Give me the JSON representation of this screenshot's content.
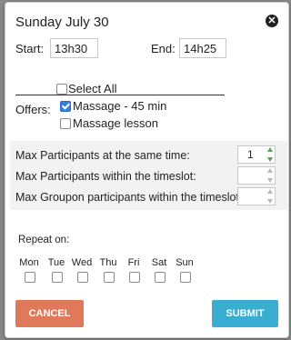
{
  "dialog": {
    "title": "Sunday July 30",
    "close_glyph": "✕"
  },
  "time": {
    "start_label": "Start:",
    "start_value": "13h30",
    "end_label": "End:",
    "end_value": "14h25"
  },
  "offers": {
    "label": "Offers:",
    "select_all_label": "Select All",
    "select_all_checked": false,
    "items": [
      {
        "label": "Massage - 45 min",
        "checked": true
      },
      {
        "label": "Massage lesson",
        "checked": false
      }
    ]
  },
  "participants": {
    "max_same_time_label": "Max Participants at the same time:",
    "max_same_time_value": "1",
    "max_timeslot_label": "Max Participants within the timeslot:",
    "max_timeslot_value": "",
    "max_groupon_label": "Max Groupon participants within the timeslot:",
    "max_groupon_value": ""
  },
  "repeat": {
    "label": "Repeat on:",
    "days": [
      "Mon",
      "Tue",
      "Wed",
      "Thu",
      "Fri",
      "Sat",
      "Sun"
    ]
  },
  "buttons": {
    "cancel": "CANCEL",
    "submit": "SUBMIT"
  },
  "colors": {
    "cancel": "#e0795a",
    "submit": "#3aaed0",
    "checkbox_checked": "#3b7fd6"
  }
}
